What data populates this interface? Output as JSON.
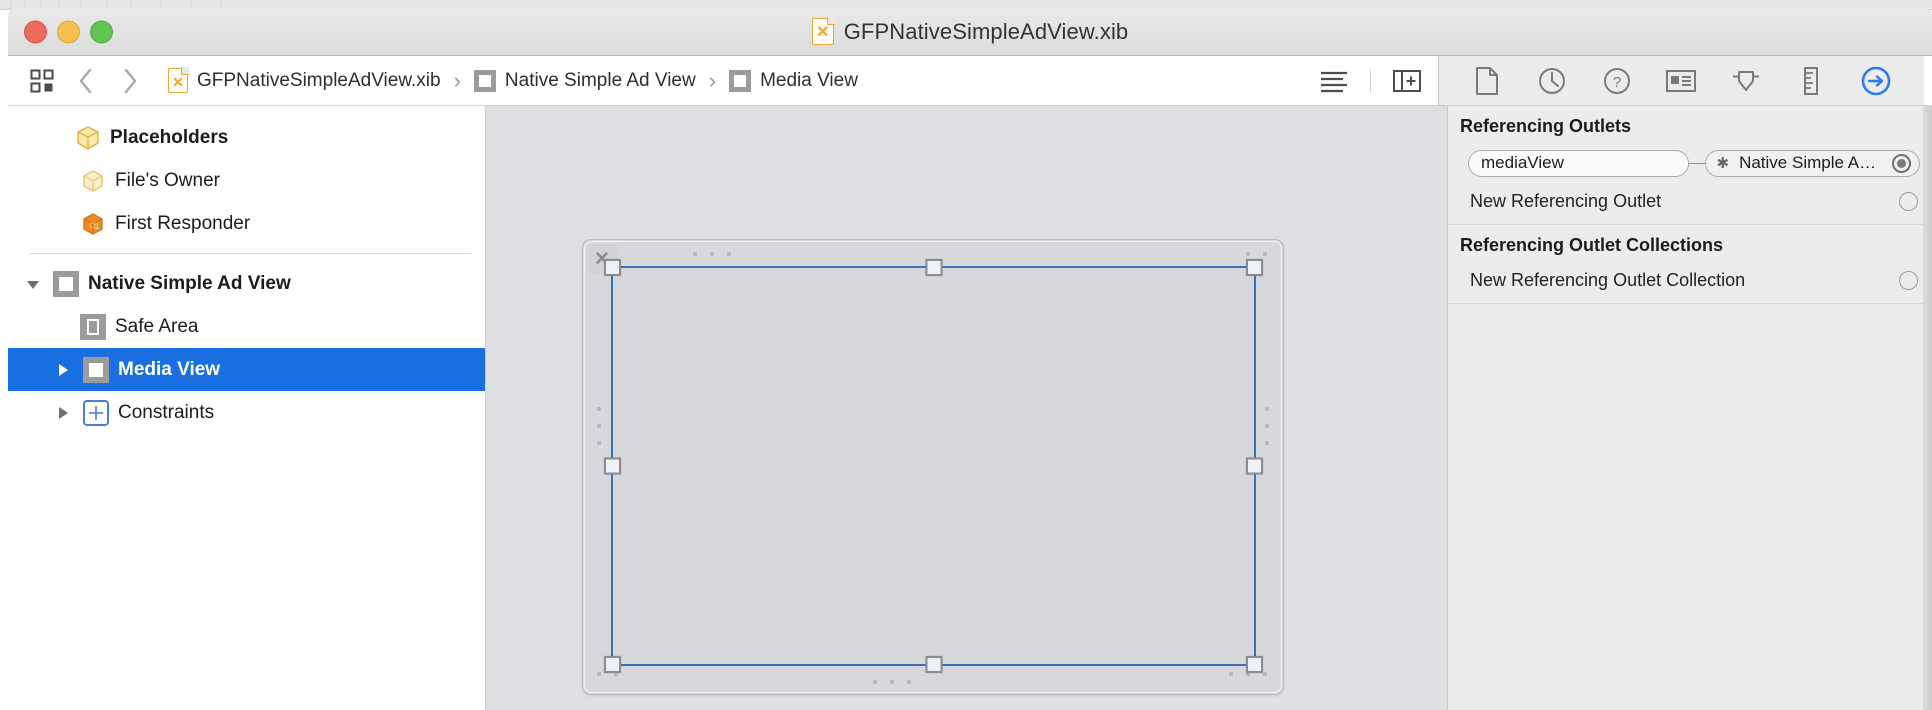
{
  "window": {
    "title": "GFPNativeSimpleAdView.xib",
    "file_icon": "xib-file-icon",
    "traffic_lights": [
      "close-button",
      "minimize-button",
      "zoom-button"
    ]
  },
  "jumpbar": {
    "related_items_icon": "related-items-icon",
    "back_label": "‹",
    "forward_label": "›",
    "crumbs": [
      {
        "label": "GFPNativeSimpleAdView.xib",
        "icon": "xib-file-icon"
      },
      {
        "label": "Native Simple Ad View",
        "icon": "view-square-icon"
      },
      {
        "label": "Media View",
        "icon": "view-square-icon"
      }
    ],
    "separator": "›",
    "right_buttons": [
      {
        "name": "document-outline-button",
        "icon": "lines-icon"
      },
      {
        "name": "add-editor-button",
        "icon": "panel-plus-icon"
      }
    ]
  },
  "outline": {
    "items": [
      {
        "label": "Placeholders",
        "icon": "cube-yellow-icon",
        "indent": 0,
        "bold": true,
        "triangle": "none",
        "selected": false
      },
      {
        "label": "File's Owner",
        "icon": "cube-yellow-icon",
        "indent": 1,
        "bold": false,
        "triangle": "none",
        "selected": false
      },
      {
        "label": "First Responder",
        "icon": "cube-orange-responder-icon",
        "indent": 1,
        "bold": false,
        "triangle": "none",
        "selected": false
      },
      {
        "label": "Native Simple Ad View",
        "icon": "view-square-icon",
        "indent": 0,
        "bold": true,
        "triangle": "down",
        "selected": false
      },
      {
        "label": "Safe Area",
        "icon": "safe-area-icon",
        "indent": 1,
        "bold": false,
        "triangle": "none",
        "selected": false
      },
      {
        "label": "Media View",
        "icon": "view-square-filled-icon",
        "indent": 1,
        "bold": false,
        "triangle": "right",
        "selected": true
      },
      {
        "label": "Constraints",
        "icon": "constraints-icon",
        "indent": 1,
        "bold": false,
        "triangle": "right",
        "selected": false
      }
    ]
  },
  "canvas": {
    "close_badge": "✕",
    "selected_object": "Media View"
  },
  "inspector": {
    "tabs": [
      {
        "name": "file-inspector-tab",
        "icon": "file-icon",
        "active": false
      },
      {
        "name": "history-inspector-tab",
        "icon": "clock-icon",
        "active": false
      },
      {
        "name": "quick-help-inspector-tab",
        "icon": "question-icon",
        "active": false
      },
      {
        "name": "identity-inspector-tab",
        "icon": "id-card-icon",
        "active": false
      },
      {
        "name": "attributes-inspector-tab",
        "icon": "attributes-arrow-icon",
        "active": false
      },
      {
        "name": "size-inspector-tab",
        "icon": "ruler-icon",
        "active": false
      },
      {
        "name": "connections-inspector-tab",
        "icon": "connections-arrow-circle-icon",
        "active": true
      }
    ],
    "active_tab_color": "#2b7cf2",
    "sections": [
      {
        "title": "Referencing Outlets",
        "connected": [
          {
            "name": "mediaView",
            "target": "Native Simple A…",
            "remove_glyph": "✱",
            "connector": "filled"
          }
        ],
        "new_row": {
          "label": "New Referencing Outlet",
          "connector": "empty"
        }
      },
      {
        "title": "Referencing Outlet Collections",
        "connected": [],
        "new_row": {
          "label": "New Referencing Outlet Collection",
          "connector": "empty"
        }
      }
    ]
  },
  "colors": {
    "selection_blue": "#1a6fe0",
    "canvas_bg": "#dee0e3",
    "view_bg": "#d7d8dc",
    "outline_border": "#3a72b8",
    "inspector_bg": "#ececec"
  }
}
